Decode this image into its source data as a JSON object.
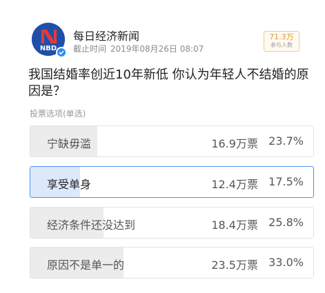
{
  "source": {
    "name": "每日经济新闻",
    "logo_text": "NBD",
    "cutoff_label": "截止时间",
    "cutoff_time": "2019年08月26日 08:07"
  },
  "participants": {
    "count": "71.3万",
    "label": "参与人数"
  },
  "question": "我国结婚率创近10年新低 你认为年轻人不结婚的原因是？",
  "options_label": "投票选项(单选)",
  "options": [
    {
      "label": "宁缺毋滥",
      "votes": "16.9万票",
      "percent": "23.7%",
      "share": 0.237,
      "selected": false
    },
    {
      "label": "享受单身",
      "votes": "12.4万票",
      "percent": "17.5%",
      "share": 0.175,
      "selected": true
    },
    {
      "label": "经济条件还没达到",
      "votes": "18.4万票",
      "percent": "25.8%",
      "share": 0.258,
      "selected": false
    },
    {
      "label": "原因不是单一的",
      "votes": "23.5万票",
      "percent": "33.0%",
      "share": 0.33,
      "selected": false
    }
  ],
  "colors": {
    "accent": "#4a8ff0",
    "badge": "#e2962c",
    "logo_bg": "#1f4fa8"
  },
  "icons": [
    "nbd-logo-icon",
    "verified-check-icon"
  ]
}
